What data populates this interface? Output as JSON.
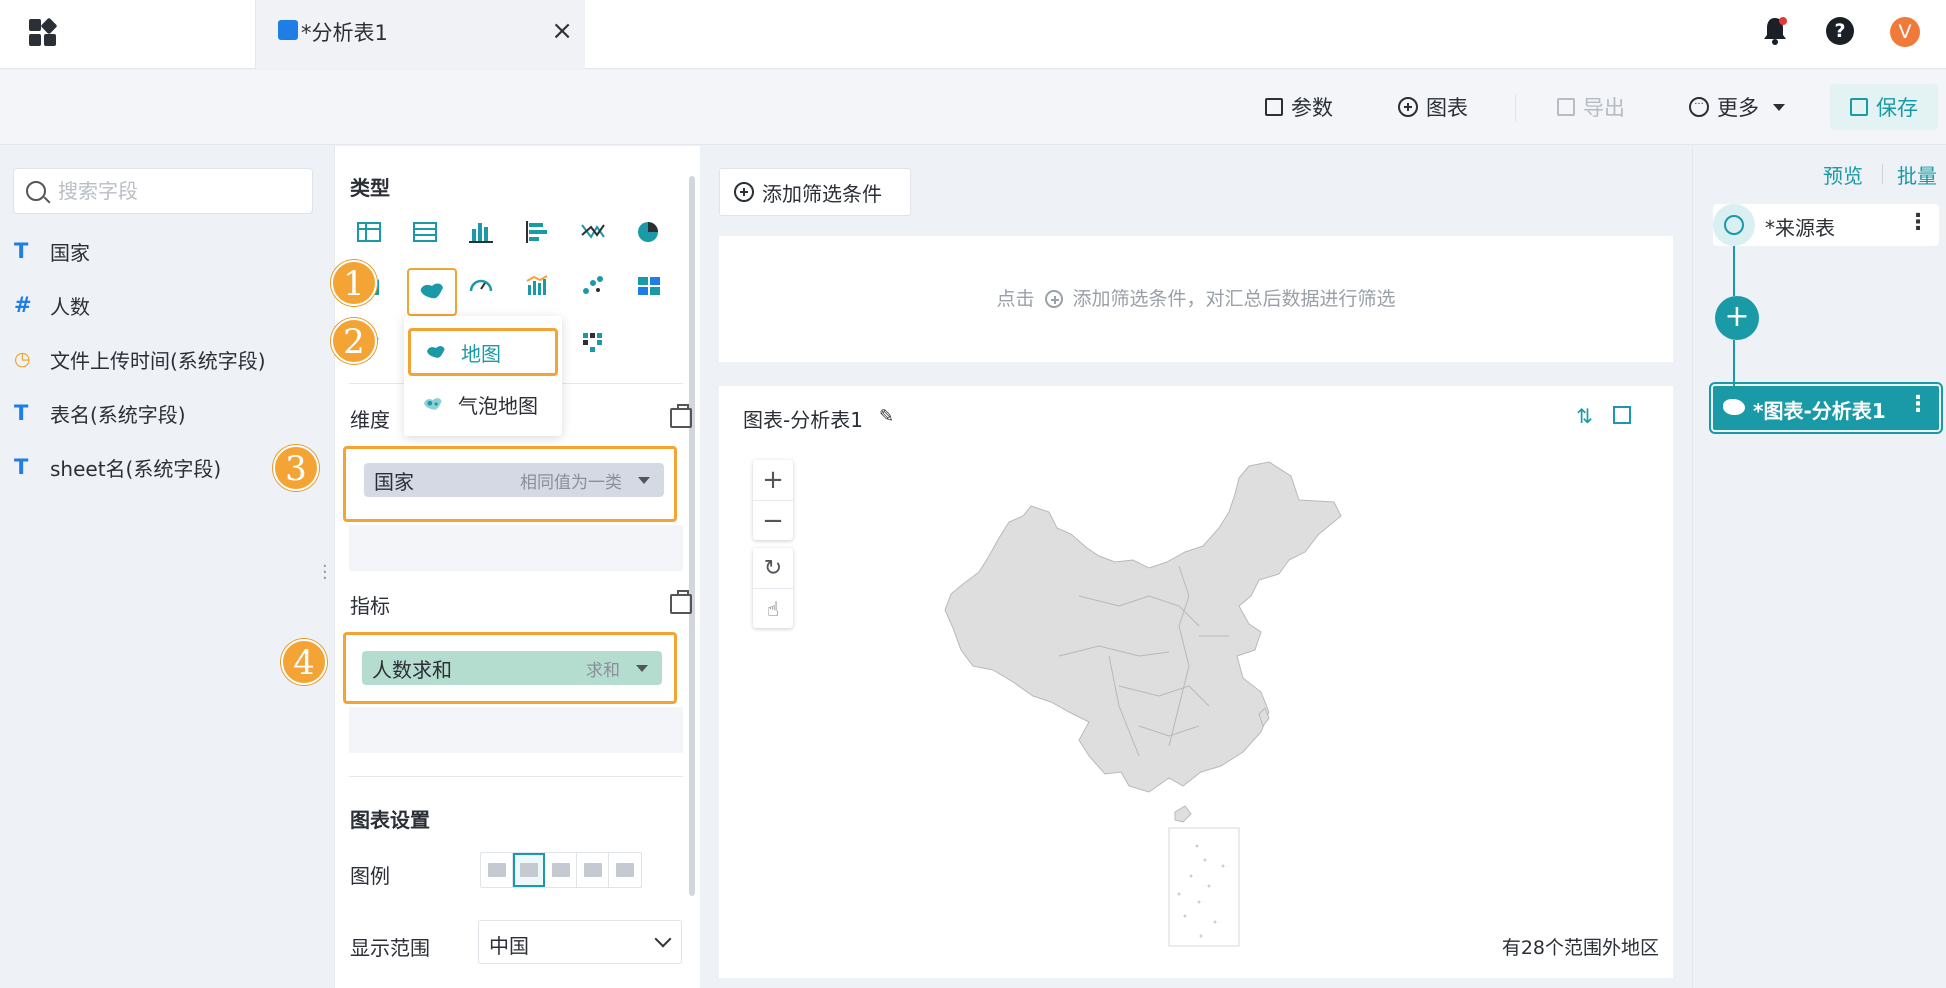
{
  "tab": {
    "title": "*分析表1"
  },
  "toolbar": {
    "params": "参数",
    "chart": "图表",
    "export": "导出",
    "more": "更多",
    "save": "保存"
  },
  "user": {
    "avatar": "V"
  },
  "left": {
    "search_placeholder": "搜索字段",
    "fields": [
      {
        "icon": "T",
        "label": "国家"
      },
      {
        "icon": "#",
        "label": "人数"
      },
      {
        "icon": "clock",
        "label": "文件上传时间(系统字段)"
      },
      {
        "icon": "T",
        "label": "表名(系统字段)"
      },
      {
        "icon": "T",
        "label": "sheet名(系统字段)"
      }
    ]
  },
  "config": {
    "type_heading": "类型",
    "dropdown": [
      "地图",
      "气泡地图"
    ],
    "dimension_label": "维度",
    "dimension_chip": {
      "label": "国家",
      "mode": "相同值为一类"
    },
    "metric_label": "指标",
    "metric_chip": {
      "label": "人数求和",
      "mode": "求和"
    },
    "settings_heading": "图表设置",
    "legend_label": "图例",
    "range_label": "显示范围",
    "range_value": "中国",
    "markers": [
      "1",
      "2",
      "3",
      "4"
    ]
  },
  "main": {
    "add_filter": "添加筛选条件",
    "filter_hint_pre": "点击",
    "filter_hint_post": "添加筛选条件，对汇总后数据进行筛选",
    "chart_title": "图表-分析表1",
    "out_of_range": "有28个范围外地区"
  },
  "right": {
    "preview": "预览",
    "batch": "批量",
    "source_node": "*来源表",
    "chart_node": "*图表-分析表1"
  },
  "colors": {
    "accent": "#1a9aa6",
    "highlight": "#f3a434",
    "dim_chip": "#d5d9e4",
    "metric_chip": "#b4ddd0",
    "map_fill": "#dedede"
  }
}
